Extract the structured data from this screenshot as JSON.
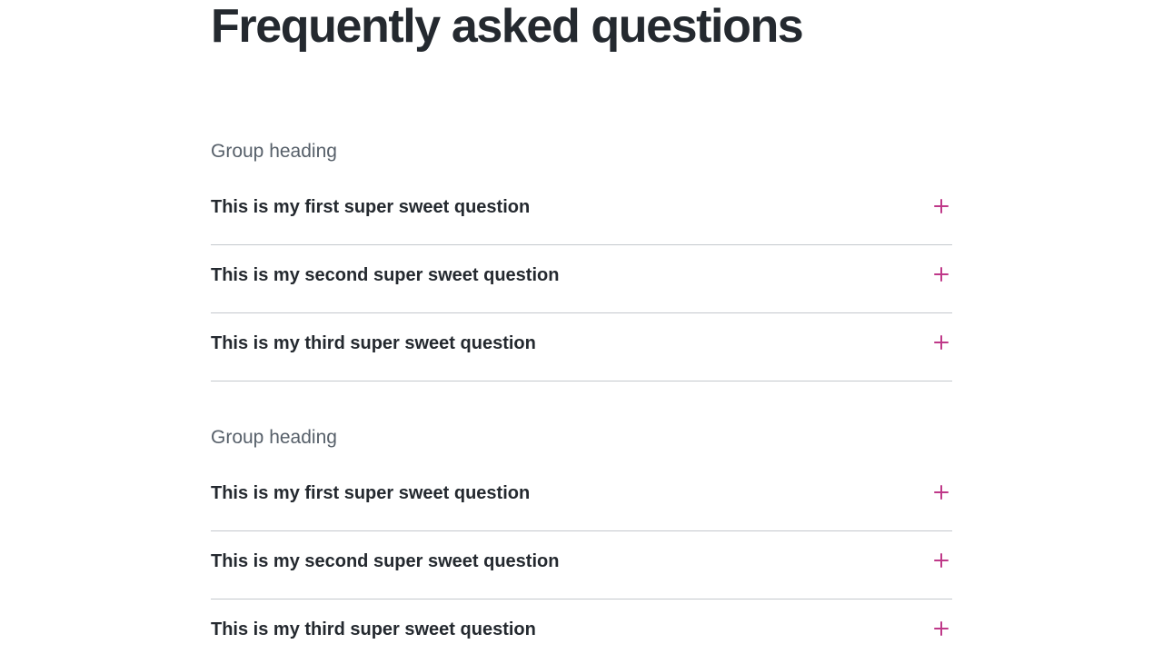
{
  "page": {
    "title": "Frequently asked questions"
  },
  "groups": [
    {
      "heading": "Group heading",
      "items": [
        {
          "question": "This is my first super sweet question",
          "icon": "plus-icon",
          "expanded": false
        },
        {
          "question": "This is my second super sweet question",
          "icon": "plus-icon",
          "expanded": false
        },
        {
          "question": "This is my third super sweet question",
          "icon": "plus-icon",
          "expanded": false
        }
      ]
    },
    {
      "heading": "Group heading",
      "items": [
        {
          "question": "This is my first super sweet question",
          "icon": "plus-icon",
          "expanded": false
        },
        {
          "question": "This is my second super sweet question",
          "icon": "plus-icon",
          "expanded": false
        },
        {
          "question": "This is my third super sweet question",
          "icon": "plus-icon",
          "expanded": false
        }
      ]
    }
  ],
  "colors": {
    "text": "#24292f",
    "muted": "#57606a",
    "accent": "#bf3989",
    "divider": "#c4c8cc",
    "background": "#ffffff"
  }
}
